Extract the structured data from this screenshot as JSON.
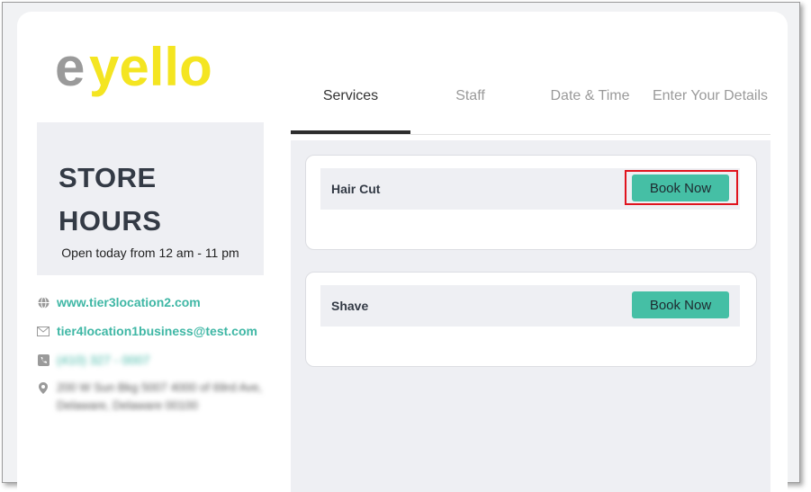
{
  "brand": {
    "logo_prefix": "e",
    "logo_rest": "yello",
    "logo_grey": "#9a9a9a",
    "logo_yellow": "#f4e521"
  },
  "store": {
    "title_line1": "STORE",
    "title_line2": "HOURS",
    "hours_text": "Open today from 12 am - 11 pm"
  },
  "contact": {
    "website": "www.tier3location2.com",
    "email": "tier4location1business@test.com",
    "phone": "(410) 327 - 0007",
    "address": "200 W Sun Bkg 5007 4000 of 69rd Ave, Delaware, Delaware 00100"
  },
  "tabs": [
    {
      "label": "Services"
    },
    {
      "label": "Staff"
    },
    {
      "label": "Date & Time"
    },
    {
      "label": "Enter Your Details"
    }
  ],
  "services": [
    {
      "name": "Hair Cut",
      "button_label": "Book Now"
    },
    {
      "name": "Shave",
      "button_label": "Book Now"
    }
  ],
  "colors": {
    "accent": "#45bfa5",
    "highlight": "#e0141e",
    "link": "#3fb7a5"
  }
}
